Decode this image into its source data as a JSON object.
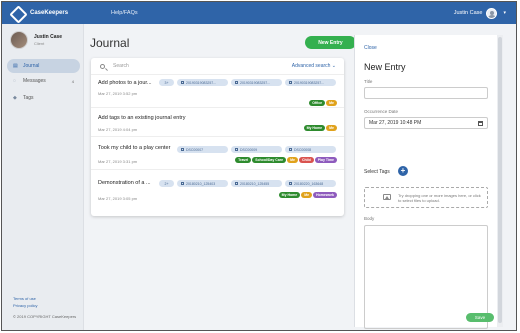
{
  "app": {
    "brand": "CaseKeepers",
    "nav_help": "Help/FAQs",
    "user_name": "Justin Case",
    "accent_color": "#2f64a8"
  },
  "sidebar": {
    "profile_name": "Justin Case",
    "profile_role": "Client",
    "items": [
      {
        "label": "Journal",
        "icon": "journal-icon",
        "active": true
      },
      {
        "label": "Messages",
        "icon": "messages-icon",
        "count": "4"
      },
      {
        "label": "Tags",
        "icon": "tag-icon"
      }
    ],
    "footer_terms": "Terms of use",
    "footer_privacy": "Privacy policy",
    "copyright": "© 2019 COPYRIGHT CaseKeepers"
  },
  "main": {
    "title": "Journal",
    "new_entry_label": "New Entry",
    "search_placeholder": "Search",
    "advanced_search_label": "Advanced search ⌄"
  },
  "entries": [
    {
      "title": "Add photos to a jour...",
      "date": "Mar 27, 2019 3:52 pm",
      "chips": [
        "3+",
        "20190319083257...",
        "20190319083257...",
        "20190319083257..."
      ],
      "tags": [
        {
          "label": "Office",
          "color": "#2e8b2e"
        },
        {
          "label": "Me",
          "color": "#e0a21c"
        }
      ]
    },
    {
      "title": "Add tags to an existing journal entry",
      "date": "Mar 27, 2019 4:04 pm",
      "chips": [],
      "tags": [
        {
          "label": "My Home",
          "color": "#2e8b2e"
        },
        {
          "label": "Me",
          "color": "#e0a21c"
        }
      ]
    },
    {
      "title": "Took my child to a play center",
      "date": "Mar 27, 2019 3:31 pm",
      "chips": [
        "DSC00007",
        "DSC00009",
        "DSC00008"
      ],
      "tags": [
        {
          "label": "Travel",
          "color": "#2e8b2e"
        },
        {
          "label": "School/Day Care",
          "color": "#2e8b2e"
        },
        {
          "label": "Me",
          "color": "#e0a21c"
        },
        {
          "label": "Child",
          "color": "#d9534f"
        },
        {
          "label": "Play Time",
          "color": "#8e5bbd"
        }
      ]
    },
    {
      "title": "Demonstration of a ...",
      "date": "Mar 27, 2019 3:05 pm",
      "chips": [
        "2+",
        "20180210_125403",
        "20180210_125455",
        "20180220_163648"
      ],
      "tags": [
        {
          "label": "My Home",
          "color": "#2e8b2e"
        },
        {
          "label": "Me",
          "color": "#e0a21c"
        },
        {
          "label": "Homework",
          "color": "#8e5bbd"
        }
      ]
    }
  ],
  "panel": {
    "close_label": "Close",
    "title": "New Entry",
    "title_label": "Title",
    "title_value": "",
    "occurrence_label": "Occurrence Date",
    "occurrence_value": "Mar 27, 2019 10:48 PM",
    "select_tags_label": "Select Tags",
    "add_tag_symbol": "+",
    "dropzone_text": "Try dropping one or more images here, or click to select files to upload.",
    "body_label": "Body",
    "save_label": "Save"
  }
}
